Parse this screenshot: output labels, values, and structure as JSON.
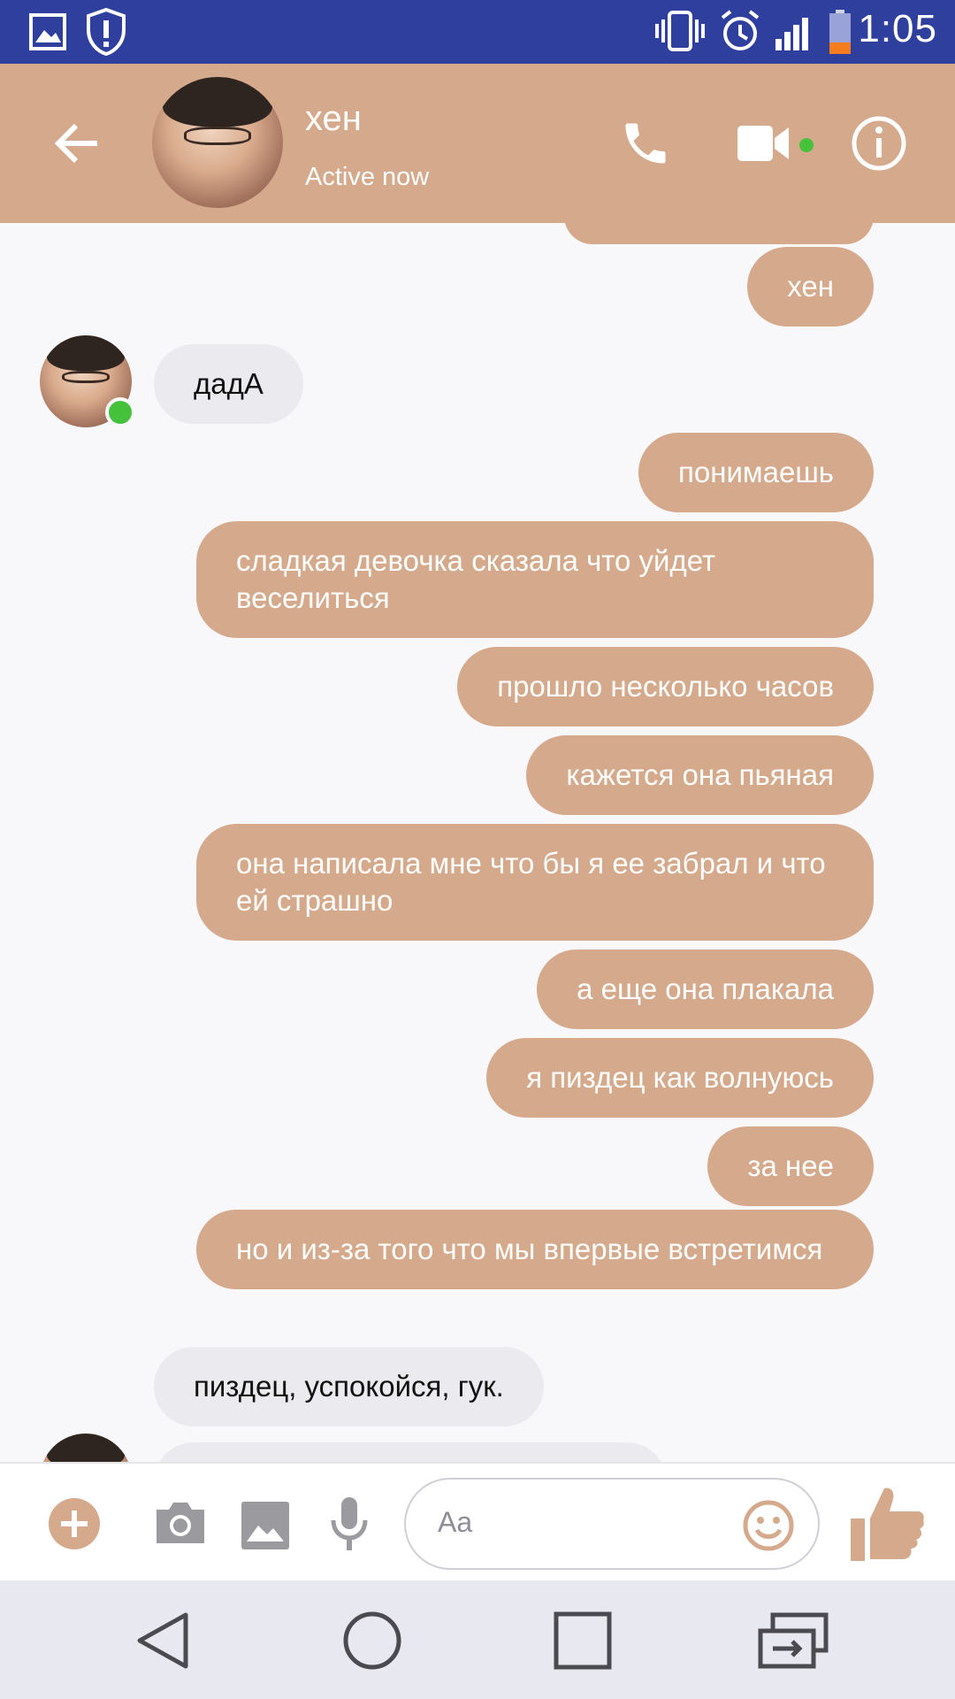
{
  "status_bar": {
    "time": "1:05",
    "icons": [
      "gallery-icon",
      "shield-alert-icon",
      "vibrate-icon",
      "alarm-icon",
      "signal-icon",
      "battery-low-icon"
    ]
  },
  "header": {
    "contact_name": "хен",
    "status": "Active now",
    "icons": [
      "back-arrow-icon",
      "phone-icon",
      "video-camera-icon",
      "info-icon"
    ]
  },
  "messages": [
    {
      "side": "out",
      "text": ""
    },
    {
      "side": "out",
      "text": "хен"
    },
    {
      "side": "in",
      "text": "дадА"
    },
    {
      "side": "out",
      "text": "понимаешь"
    },
    {
      "side": "out",
      "text": "сладкая девочка сказала что уйдет веселиться"
    },
    {
      "side": "out",
      "text": "прошло несколько часов"
    },
    {
      "side": "out",
      "text": "кажется она пьяная"
    },
    {
      "side": "out",
      "text": "она написала мне что бы я ее забрал и что ей страшно"
    },
    {
      "side": "out",
      "text": "а еще она плакала"
    },
    {
      "side": "out",
      "text": "я пиздец как волнуюсь"
    },
    {
      "side": "out",
      "text": "за нее"
    },
    {
      "side": "out",
      "text": "но и из-за того что мы впервые встретимся"
    },
    {
      "side": "in",
      "text": "пиздец, успокойся, гук."
    },
    {
      "side": "in",
      "text": ""
    }
  ],
  "composer": {
    "placeholder": "Aa",
    "icons": [
      "plus-icon",
      "camera-icon",
      "image-icon",
      "microphone-icon",
      "emoji-icon",
      "thumbs-up-icon"
    ]
  },
  "nav_bar": {
    "icons": [
      "back-triangle-icon",
      "home-circle-icon",
      "recents-square-icon",
      "switch-app-icon"
    ]
  },
  "colors": {
    "accent": "#d5a98b",
    "status_bar": "#2f3f9e",
    "incoming_bubble": "#ebeaef",
    "online": "#45c13c"
  }
}
